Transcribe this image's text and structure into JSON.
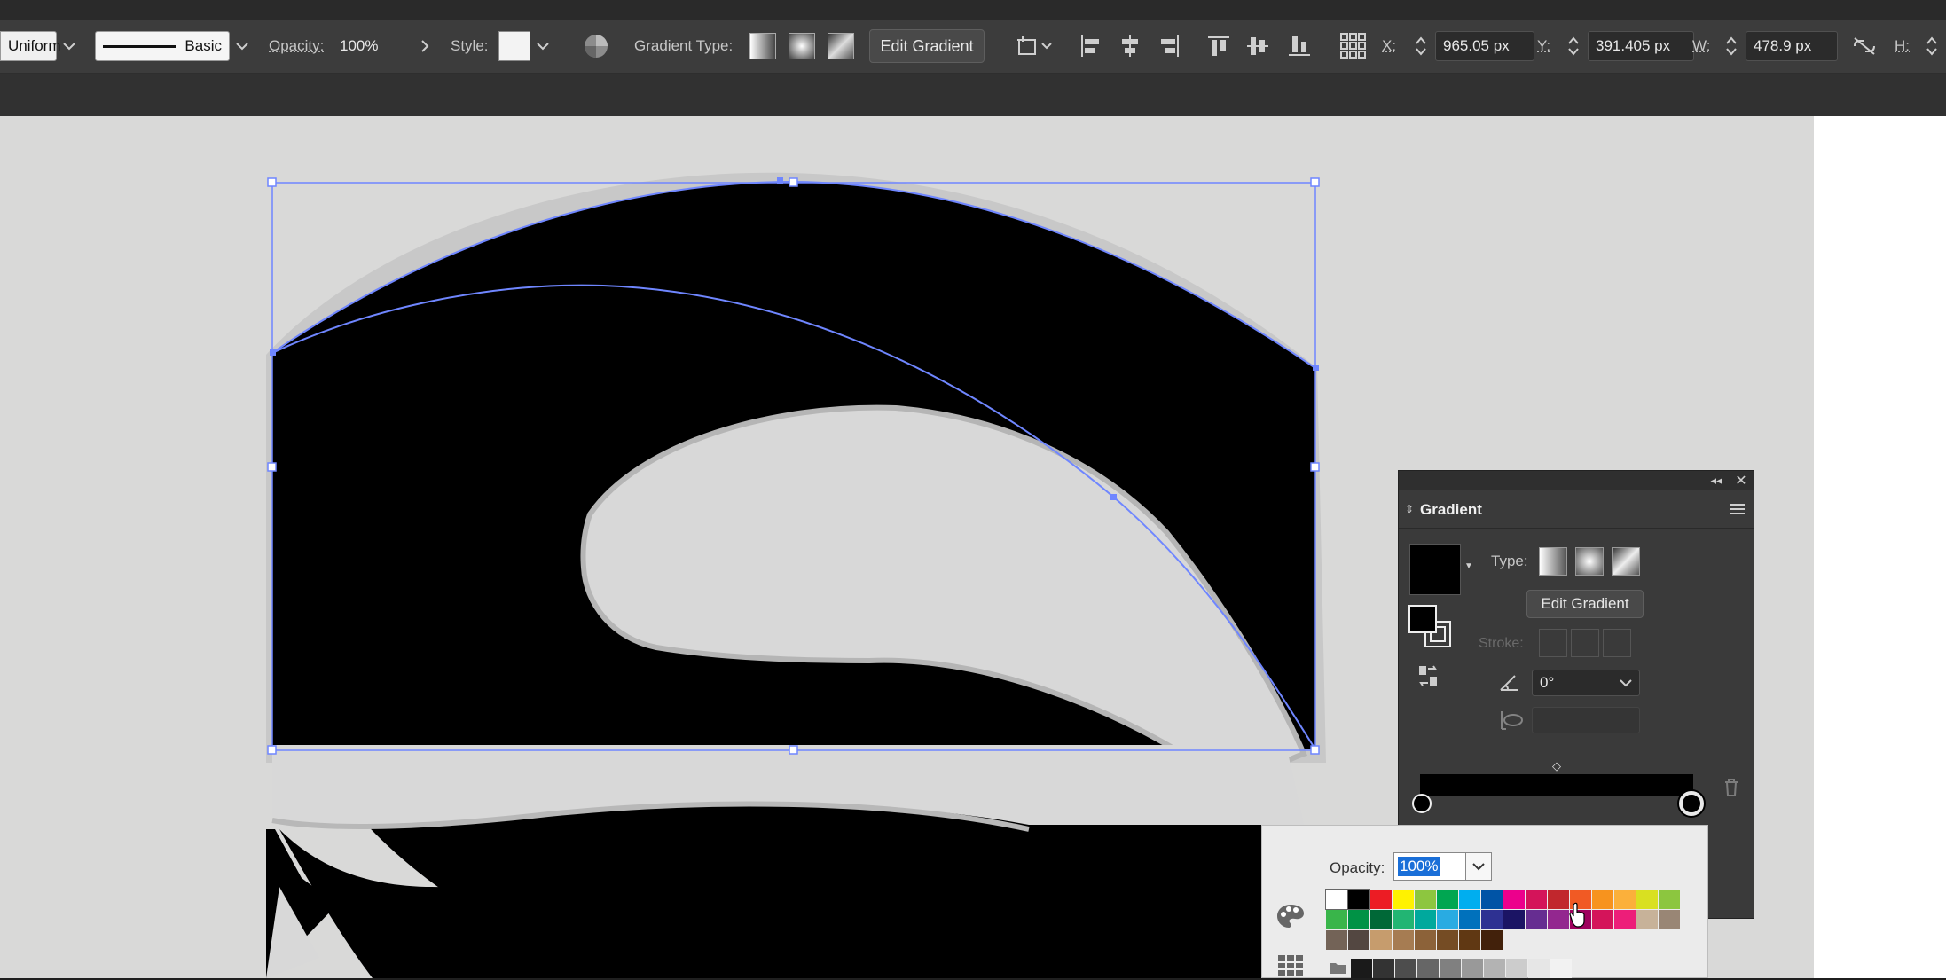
{
  "toolbar": {
    "stroke_profile": "Uniform",
    "brush": "Basic",
    "opacity_label": "Opacity:",
    "opacity_value": "100%",
    "style_label": "Style:",
    "gradient_type_label": "Gradient Type:",
    "edit_gradient": "Edit Gradient",
    "x_label": "X:",
    "x_value": "965.05 px",
    "y_label": "Y:",
    "y_value": "391.405 px",
    "w_label": "W:",
    "w_value": "478.9 px",
    "h_label": "H:"
  },
  "gradient_panel": {
    "title": "Gradient",
    "type_label": "Type:",
    "edit_gradient": "Edit Gradient",
    "stroke_label": "Stroke:",
    "angle_value": "0°"
  },
  "color_popup": {
    "opacity_label": "Opacity:",
    "opacity_value": "100%",
    "swatches_row1": [
      "#ffffff",
      "#000000",
      "#ec1c24",
      "#fff200",
      "#8dc63f",
      "#00a651",
      "#00aeef",
      "#0054a6",
      "#ec008c",
      "#d4145a",
      "#c1272d",
      "#f15a24",
      "#f7931e",
      "#fbb03b",
      "#d9e021",
      "#8cc63f"
    ],
    "swatches_row2": [
      "#39b54a",
      "#009245",
      "#006837",
      "#22b573",
      "#00a99d",
      "#29abe2",
      "#0071bc",
      "#2e3192",
      "#1b1464",
      "#662d91",
      "#93278f",
      "#9e005d",
      "#d4145a",
      "#ed1e79",
      "#c7b299",
      "#998675"
    ],
    "swatches_row3": [
      "#736357",
      "#534741",
      "#c69c6d",
      "#a67c52",
      "#8c6239",
      "#754c24",
      "#603813",
      "#42210b"
    ],
    "swatches_row4": [
      "#1a1a1a",
      "#333333",
      "#4d4d4d",
      "#666666",
      "#808080",
      "#999999",
      "#b3b3b3",
      "#cccccc",
      "#e6e6e6",
      "#f2f2f2"
    ]
  },
  "colors": {
    "accent": "#6f86ff",
    "panel_bg": "#3a3a3a",
    "toolbar_bg": "#3c3c3c",
    "canvas_bg": "#d8d8d8"
  }
}
